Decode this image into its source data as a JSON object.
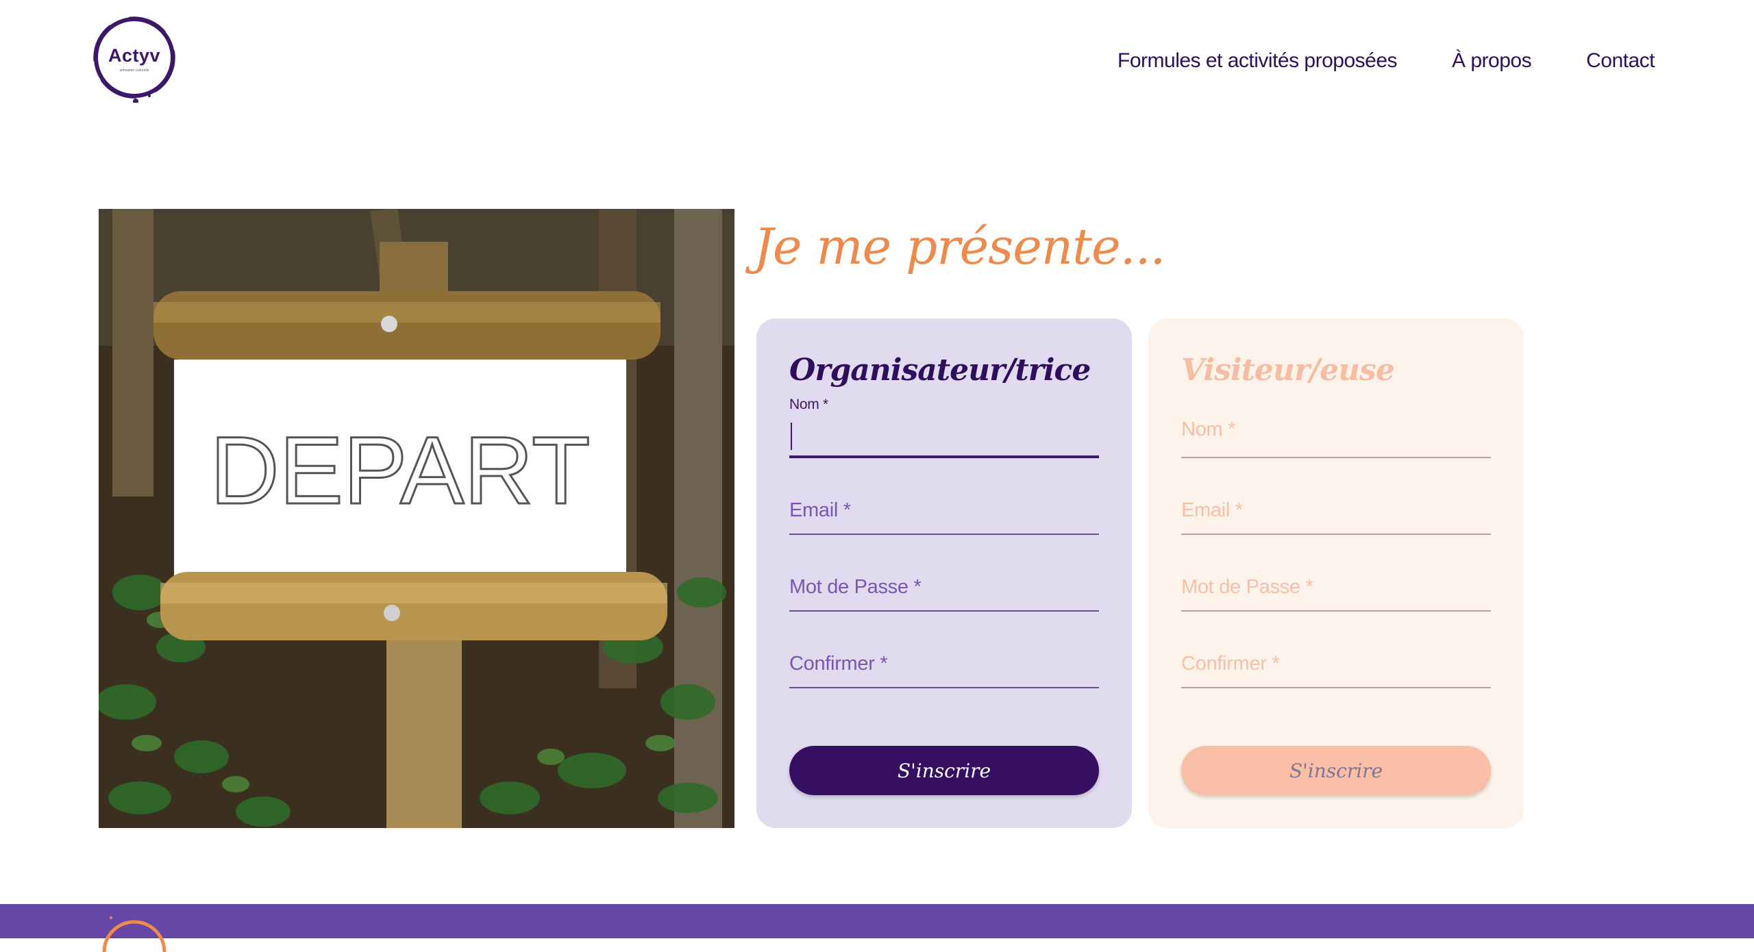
{
  "header": {
    "logo_text": "Actyv",
    "logo_subtext": "animation culturelle",
    "nav": [
      {
        "label": "Formules et activités proposées"
      },
      {
        "label": "À propos"
      },
      {
        "label": "Contact"
      }
    ]
  },
  "hero_image": {
    "sign_text": "DEPART"
  },
  "main": {
    "heading": "Je me présente..."
  },
  "organizer_card": {
    "title": "Organisateur/trice",
    "fields": [
      {
        "label": "Nom *",
        "value": ""
      },
      {
        "label": "Email *",
        "value": ""
      },
      {
        "label": "Mot de Passe *",
        "value": ""
      },
      {
        "label": "Confirmer *",
        "value": ""
      }
    ],
    "button": "S'inscrire"
  },
  "visitor_card": {
    "title": "Visiteur/euse",
    "fields": [
      {
        "label": "Nom *",
        "value": ""
      },
      {
        "label": "Email *",
        "value": ""
      },
      {
        "label": "Mot de Passe *",
        "value": ""
      },
      {
        "label": "Confirmer *",
        "value": ""
      }
    ],
    "button": "S'inscrire"
  },
  "colors": {
    "brand_purple": "#360e62",
    "accent_orange": "#ef8a4d",
    "organizer_bg": "#e1dbef",
    "visitor_bg": "#fdf3ea",
    "footer_bg": "#6447a6"
  }
}
